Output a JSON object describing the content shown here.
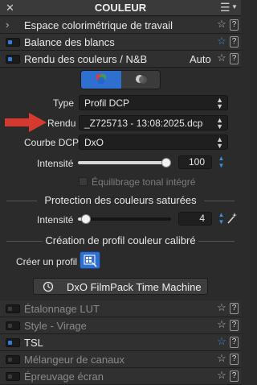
{
  "panel": {
    "title": "COULEUR"
  },
  "sections": {
    "espace": {
      "label": "Espace colorimétrique de travail"
    },
    "balance": {
      "label": "Balance des blancs"
    },
    "rendu": {
      "label": "Rendu des couleurs / N&B",
      "mode": "Auto"
    }
  },
  "rendu_controls": {
    "type_label": "Type",
    "type_value": "Profil DCP",
    "rendu_label": "Rendu",
    "rendu_value": "_Z725713 - 13:08:2025.dcp",
    "courbe_label": "Courbe DCP",
    "courbe_value": "DxO",
    "intensite_label": "Intensité",
    "intensite_value": "100",
    "intensite_level": 1.0,
    "equilibrage_label": "Équilibrage tonal intégré"
  },
  "protection": {
    "title": "Protection des couleurs saturées",
    "intensite_label": "Intensité",
    "intensite_value": "4",
    "intensite_level": 0.04
  },
  "creation": {
    "title": "Création de profil couleur calibré",
    "create_label": "Créer un profil"
  },
  "filmpack": {
    "label": "DxO FilmPack Time Machine"
  },
  "subsections": [
    {
      "label": "Étalonnage LUT",
      "enabled": false,
      "star": "gray"
    },
    {
      "label": "Style - Virage",
      "enabled": false,
      "star": "gray"
    },
    {
      "label": "TSL",
      "enabled": true,
      "star": "blue"
    },
    {
      "label": "Mélangeur de canaux",
      "enabled": false,
      "star": "gray"
    },
    {
      "label": "Épreuvage écran",
      "enabled": false,
      "star": "gray"
    }
  ],
  "colors": {
    "accent": "#3b8fe6",
    "arrow": "#d63a2f",
    "panel_bg": "#2b2b2b"
  }
}
